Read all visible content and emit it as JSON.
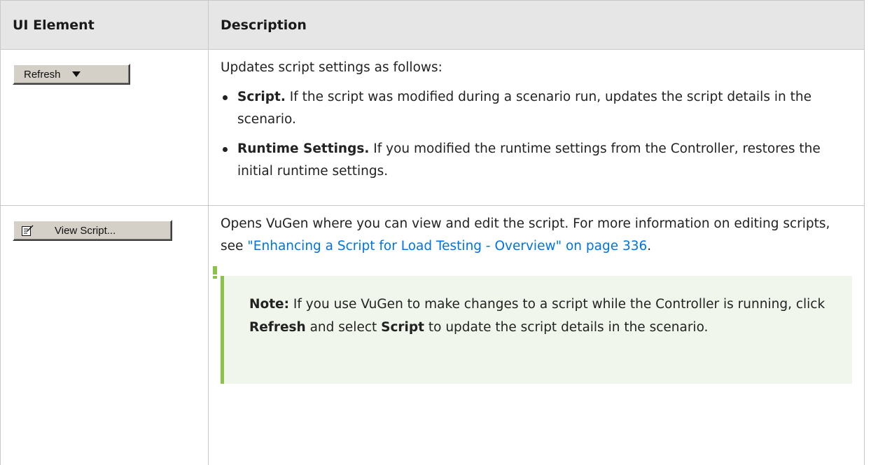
{
  "table": {
    "headers": [
      "UI Element",
      "Description"
    ],
    "rows": [
      {
        "element": {
          "label": "Refresh",
          "icon": "dropdown-arrow-icon"
        },
        "intro": "Updates script settings as follows:",
        "bullets": [
          {
            "term": "Script.",
            "text": "If the script was modified during a scenario run, updates the script details in the scenario."
          },
          {
            "term": "Runtime Settings.",
            "text": "If you modified the runtime settings from the Controller, restores the initial runtime settings."
          }
        ]
      },
      {
        "element": {
          "label": "View Script...",
          "icon": "edit-script-icon"
        },
        "text_before_link": "Opens VuGen where you can view and edit the script. For more information on editing scripts, see ",
        "link": "\"Enhancing a Script for Load Testing - Overview\" on page 336",
        "text_after_link": ".",
        "note": {
          "label": "Note:",
          "part1": "If you use VuGen to make changes to a script while the Controller is running, click",
          "bold1": "Refresh",
          "part2": "and select",
          "bold2": "Script",
          "part3": "to update the script details in the scenario."
        }
      }
    ]
  },
  "colors": {
    "link": "#0073e7",
    "note_accent": "#8bc34a",
    "note_bg": "#f0f6eb",
    "header_bg": "#e6e6e6"
  }
}
